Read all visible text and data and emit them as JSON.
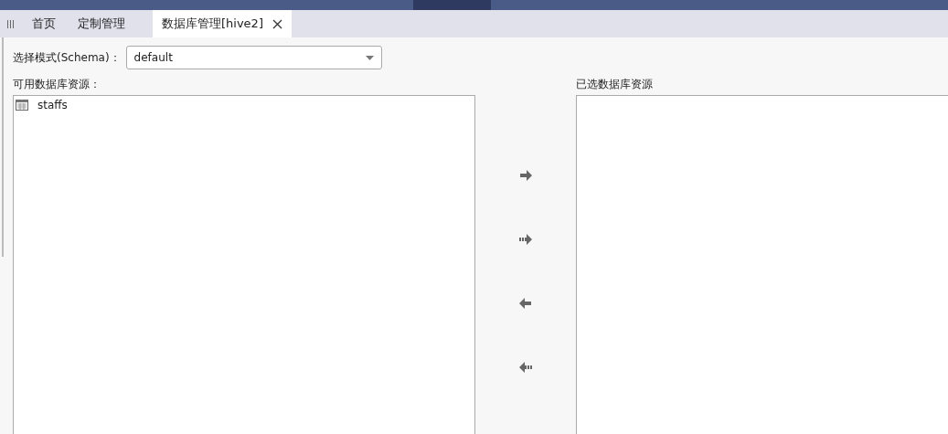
{
  "tabs": [
    {
      "label": "首页",
      "selected": false,
      "closable": false
    },
    {
      "label": "定制管理",
      "selected": false,
      "closable": false
    },
    {
      "label": "数据库管理[hive2]",
      "selected": true,
      "closable": true
    }
  ],
  "schema": {
    "label": "选择模式(Schema)：",
    "value": "default"
  },
  "available": {
    "title": "可用数据库资源：",
    "items": [
      {
        "label": "staffs",
        "kind": "table"
      }
    ]
  },
  "transfer_buttons": [
    {
      "kind": "move-right"
    },
    {
      "kind": "move-all-right"
    },
    {
      "kind": "move-left"
    },
    {
      "kind": "move-all-left"
    }
  ],
  "selected_panel": {
    "title": "已选数据库资源"
  }
}
